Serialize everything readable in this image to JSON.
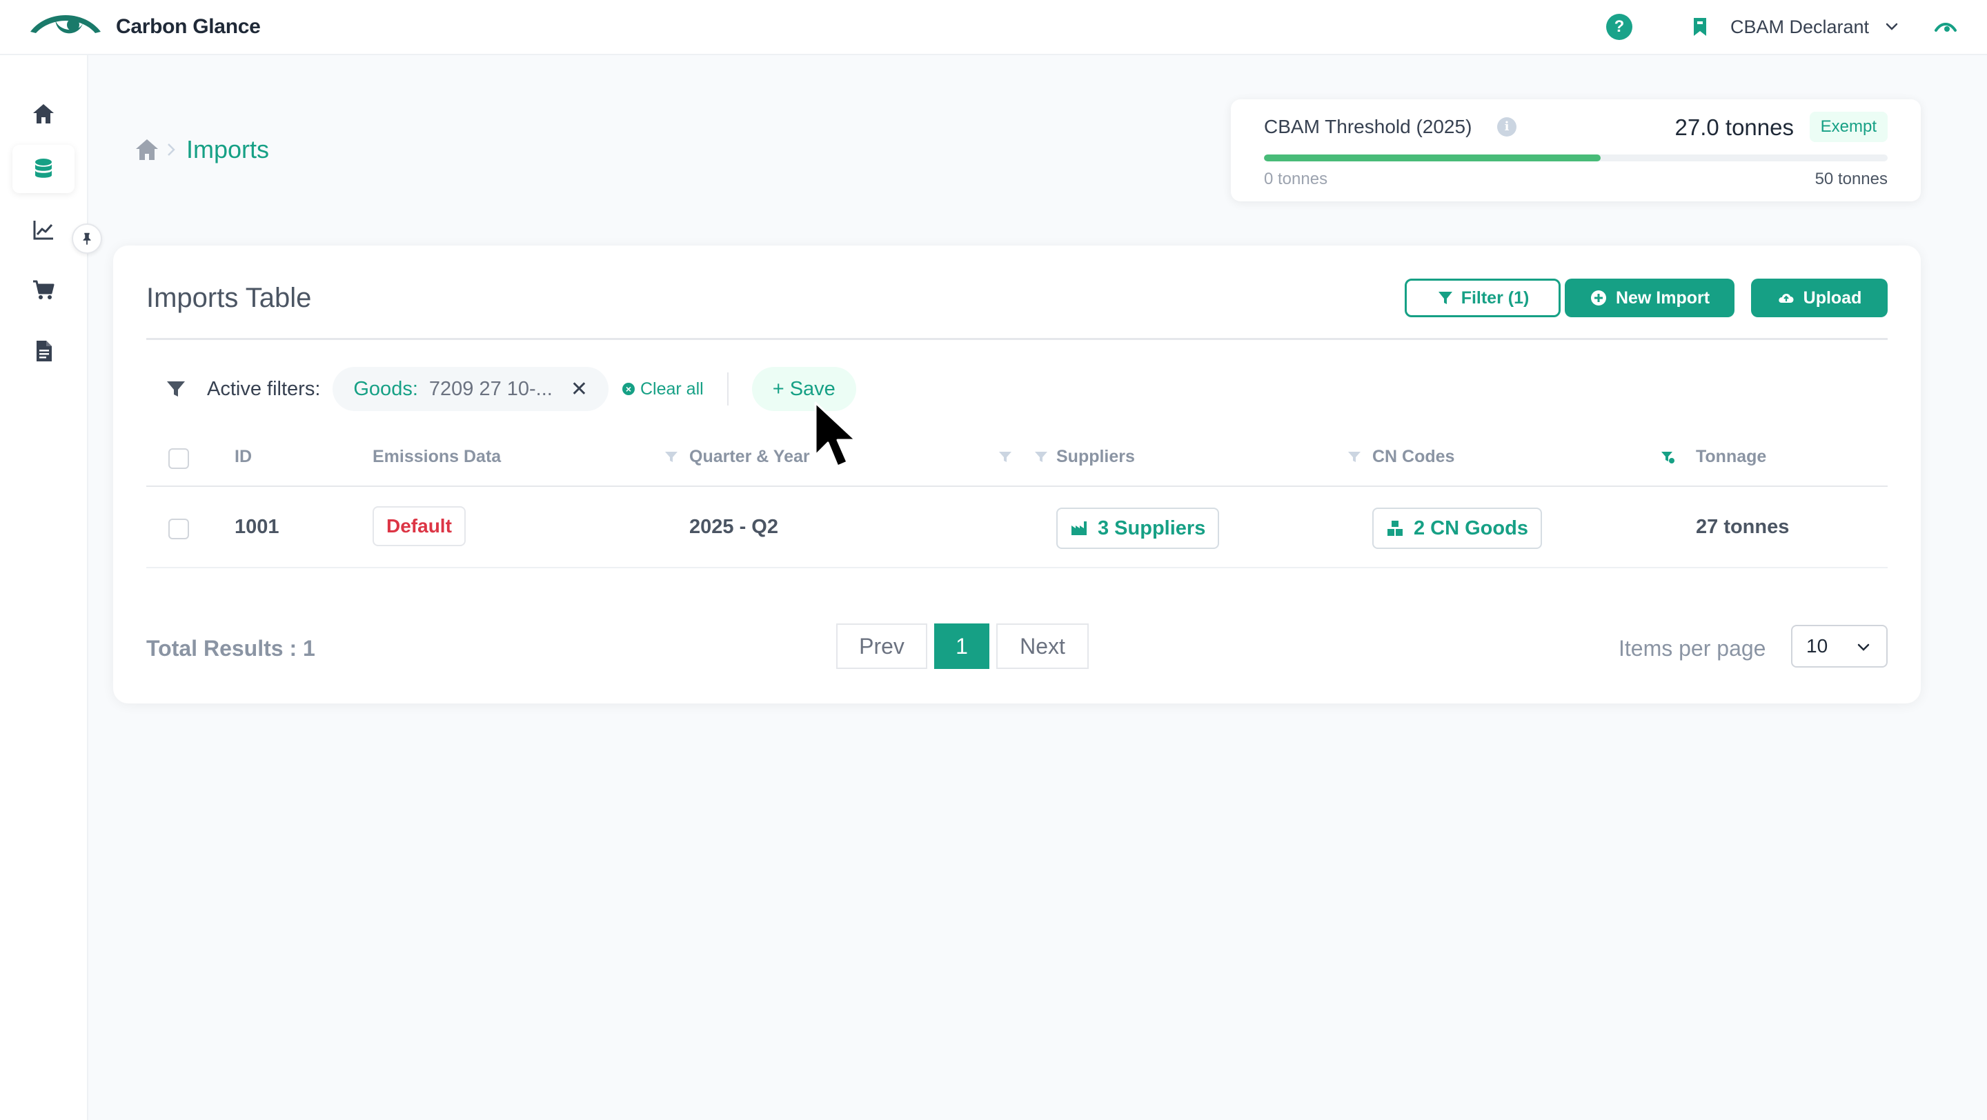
{
  "app": {
    "brand": "Carbon Glance",
    "role": "CBAM Declarant",
    "help_symbol": "?"
  },
  "breadcrumb": {
    "current": "Imports"
  },
  "threshold": {
    "title": "CBAM Threshold (2025)",
    "info_symbol": "i",
    "value": "27.0 tonnes",
    "badge": "Exempt",
    "progress_fraction": 0.54,
    "min_label": "0 tonnes",
    "max_label": "50 tonnes"
  },
  "imports": {
    "title": "Imports Table",
    "filter_label": "Filter (1)",
    "new_import_label": "New Import",
    "upload_label": "Upload",
    "active_filters_label": "Active filters:",
    "filter_chip": {
      "key": "Goods:",
      "value": "7209 27 10-...",
      "remove": "✕"
    },
    "clear_all_label": "Clear all",
    "save_label": "+ Save",
    "columns": {
      "id": "ID",
      "emissions": "Emissions Data",
      "quarter": "Quarter & Year",
      "suppliers": "Suppliers",
      "cn_codes": "CN Codes",
      "tonnage": "Tonnage"
    },
    "rows": [
      {
        "id": "1001",
        "emissions": "Default",
        "quarter": "2025 - Q2",
        "suppliers": "3 Suppliers",
        "cn_codes": "2 CN Goods",
        "tonnage": "27 tonnes"
      }
    ],
    "total_results": "Total Results : 1",
    "pager": {
      "prev": "Prev",
      "page": "1",
      "next": "Next"
    },
    "items_per_page_label": "Items per page",
    "items_per_page_value": "10"
  },
  "colors": {
    "accent": "#16a085",
    "progress": "#48bb78",
    "danger": "#dc3545"
  },
  "icons": {
    "sidebar": [
      "home-icon",
      "database-icon",
      "chart-line-icon",
      "cart-icon",
      "document-icon"
    ],
    "header": [
      "eye-logo-icon",
      "help-icon",
      "bookmark-icon",
      "chevron-down-icon",
      "eye-icon"
    ]
  }
}
